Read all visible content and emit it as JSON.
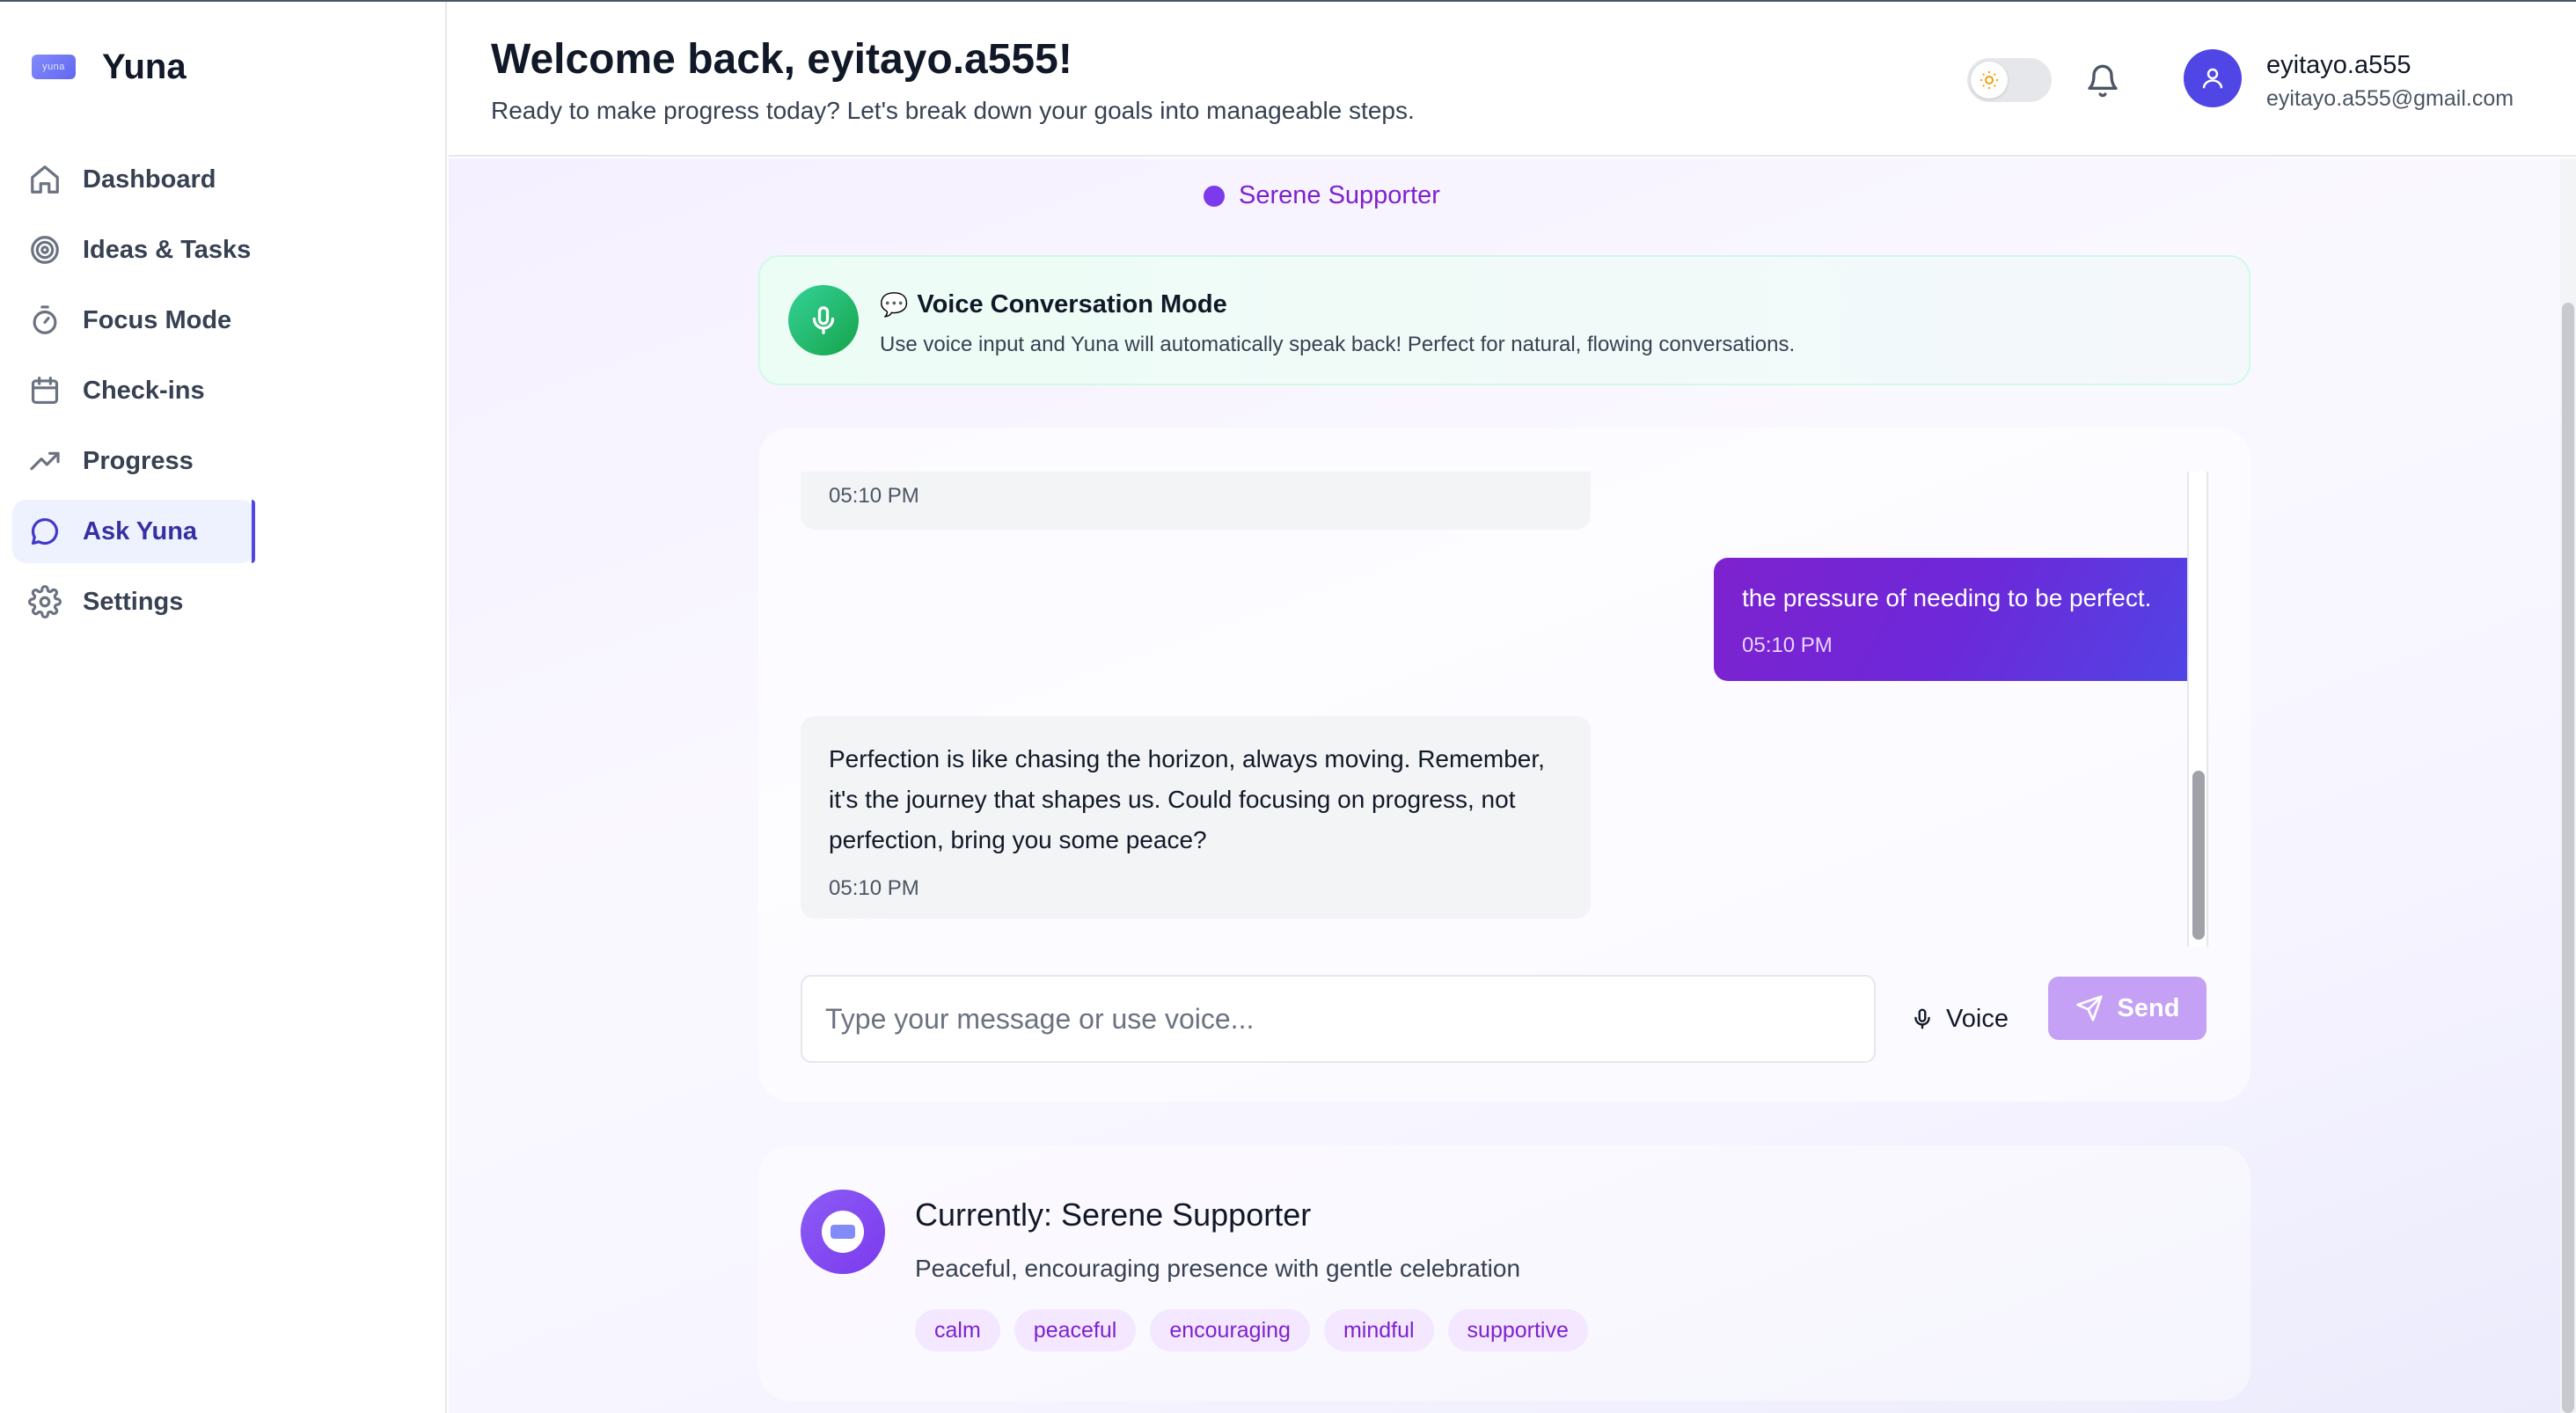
{
  "brand": {
    "name": "Yuna",
    "logo_text": "yuna"
  },
  "nav": {
    "items": [
      {
        "label": "Dashboard",
        "icon": "home-icon"
      },
      {
        "label": "Ideas & Tasks",
        "icon": "target-icon"
      },
      {
        "label": "Focus Mode",
        "icon": "timer-icon"
      },
      {
        "label": "Check-ins",
        "icon": "calendar-icon"
      },
      {
        "label": "Progress",
        "icon": "trending-up-icon"
      },
      {
        "label": "Ask Yuna",
        "icon": "chat-bubble-icon",
        "active": true
      },
      {
        "label": "Settings",
        "icon": "gear-icon"
      }
    ]
  },
  "header": {
    "title": "Welcome back, eyitayo.a555!",
    "subtitle": "Ready to make progress today? Let's break down your goals into manageable steps.",
    "user_name": "eyitayo.a555",
    "user_email": "eyitayo.a555@gmail.com"
  },
  "persona": {
    "label": "Serene Supporter"
  },
  "voice_mode": {
    "title": "Voice Conversation Mode",
    "description": "Use voice input and Yuna will automatically speak back! Perfect for natural, flowing conversations."
  },
  "messages": [
    {
      "role": "assistant",
      "text": "",
      "time": "05:10 PM"
    },
    {
      "role": "user",
      "text": "the pressure of needing to be perfect.",
      "time": "05:10 PM"
    },
    {
      "role": "assistant",
      "text": "Perfection is like chasing the horizon, always moving. Remember, it's the journey that shapes us. Could focusing on progress, not perfection, bring you some peace?",
      "time": "05:10 PM"
    }
  ],
  "composer": {
    "placeholder": "Type your message or use voice...",
    "voice_label": "Voice",
    "send_label": "Send"
  },
  "current_persona": {
    "title": "Currently: Serene Supporter",
    "description": "Peaceful, encouraging presence with gentle celebration",
    "tags": [
      "calm",
      "peaceful",
      "encouraging",
      "mindful",
      "supportive"
    ]
  },
  "colors": {
    "accent": "#4f46e5",
    "persona_purple": "#7e22ce",
    "voice_green": "#16a34a",
    "send_disabled": "#c4a1f5"
  }
}
